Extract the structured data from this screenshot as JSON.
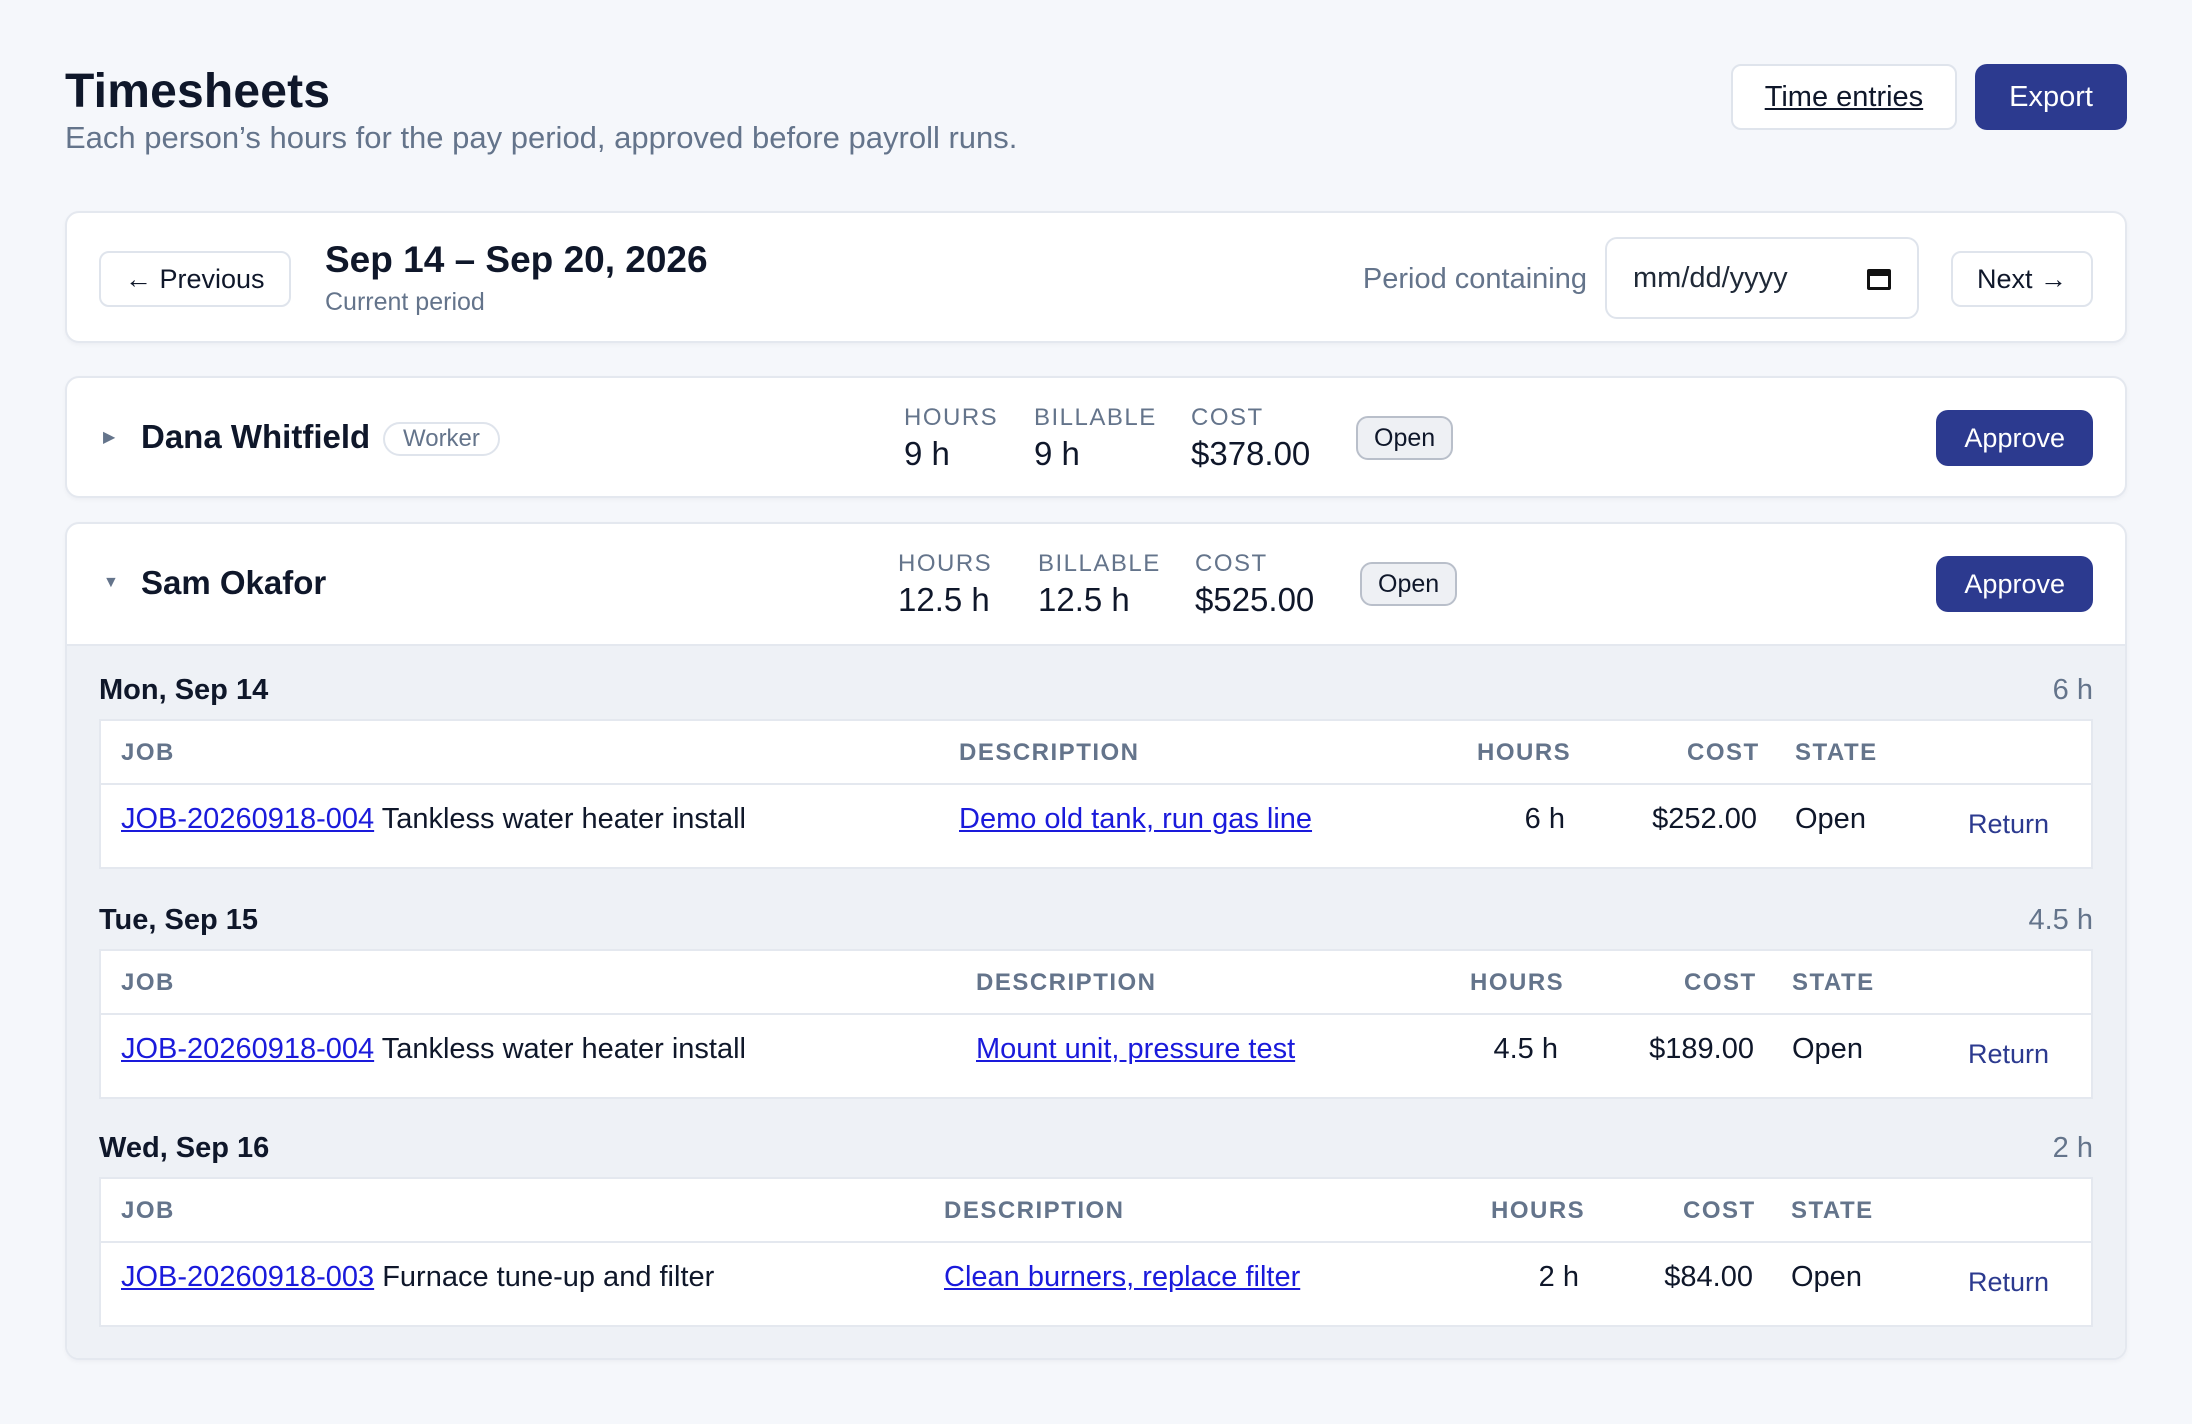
{
  "header": {
    "title": "Timesheets",
    "subtitle": "Each person’s hours for the pay period, approved before payroll runs.",
    "time_entries_label": "Time entries",
    "export_label": "Export"
  },
  "period": {
    "previous_label": "← Previous",
    "range": "Sep 14 – Sep 20, 2026",
    "note": "Current period",
    "containing_label": "Period containing",
    "date_placeholder": "mm/dd/yyyy",
    "next_label": "Next →"
  },
  "stat_labels": {
    "hours": "HOURS",
    "billable": "BILLABLE",
    "cost": "COST"
  },
  "table_headers": {
    "job": "JOB",
    "description": "DESCRIPTION",
    "hours": "HOURS",
    "cost": "COST",
    "state": "STATE"
  },
  "people": [
    {
      "name": "Dana Whitfield",
      "role": "Worker",
      "hours": "9 h",
      "billable": "9 h",
      "cost": "$378.00",
      "state": "Open",
      "approve_label": "Approve",
      "expanded": false
    },
    {
      "name": "Sam Okafor",
      "hours": "12.5 h",
      "billable": "12.5 h",
      "cost": "$525.00",
      "state": "Open",
      "approve_label": "Approve",
      "expanded": true,
      "days": [
        {
          "date": "Mon, Sep 14",
          "total": "6 h",
          "entries": [
            {
              "job_id": "JOB-20260918-004",
              "job_name": "Tankless water heater install",
              "description": "Demo old tank, run gas line",
              "hours": "6 h",
              "cost": "$252.00",
              "state": "Open",
              "action": "Return"
            }
          ]
        },
        {
          "date": "Tue, Sep 15",
          "total": "4.5 h",
          "entries": [
            {
              "job_id": "JOB-20260918-004",
              "job_name": "Tankless water heater install",
              "description": "Mount unit, pressure test",
              "hours": "4.5 h",
              "cost": "$189.00",
              "state": "Open",
              "action": "Return"
            }
          ]
        },
        {
          "date": "Wed, Sep 16",
          "total": "2 h",
          "entries": [
            {
              "job_id": "JOB-20260918-003",
              "job_name": "Furnace tune-up and filter",
              "description": "Clean burners, replace filter",
              "hours": "2 h",
              "cost": "$84.00",
              "state": "Open",
              "action": "Return"
            }
          ]
        }
      ]
    }
  ]
}
